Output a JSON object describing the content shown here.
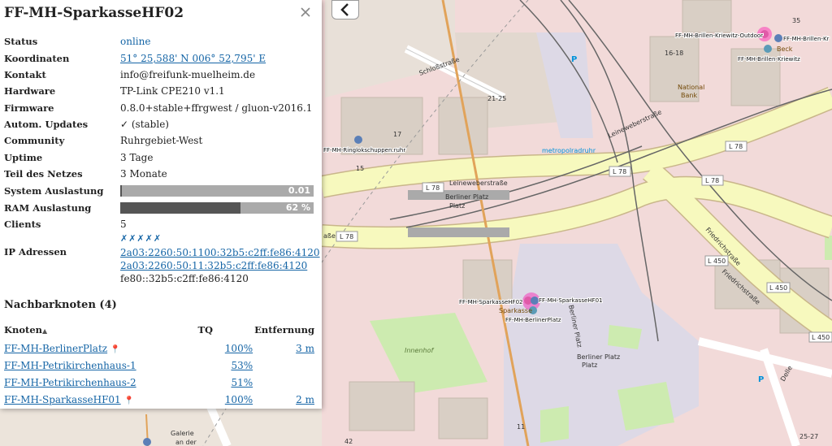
{
  "panel": {
    "title": "FF-MH-SparkasseHF02",
    "rows": {
      "status": {
        "label": "Status",
        "value": "online"
      },
      "coords": {
        "label": "Koordinaten",
        "value": "51° 25,588' N 006° 52,795' E"
      },
      "contact": {
        "label": "Kontakt",
        "value": "info@freifunk-muelheim.de"
      },
      "hardware": {
        "label": "Hardware",
        "value": "TP-Link CPE210 v1.1"
      },
      "firmware": {
        "label": "Firmware",
        "value": "0.8.0+stable+ffrgwest / gluon-v2016.1"
      },
      "autoupdate": {
        "label": "Autom. Updates",
        "value": "✓ (stable)"
      },
      "community": {
        "label": "Community",
        "value": "Ruhrgebiet-West"
      },
      "uptime": {
        "label": "Uptime",
        "value": "3 Tage"
      },
      "netpart": {
        "label": "Teil des Netzes",
        "value": "3 Monate"
      },
      "sysload": {
        "label": "System Auslastung",
        "text": "0.01",
        "fraction": 0.01
      },
      "ram": {
        "label": "RAM Auslastung",
        "text": "62 %",
        "fraction": 0.62
      },
      "clients": {
        "label": "Clients",
        "value": "5",
        "icons": "✗✗✗✗✗"
      },
      "ip": {
        "label": "IP Adressen",
        "addresses": [
          "2a03:2260:50:1100:32b5:c2ff:fe86:4120",
          "2a03:2260:50:11:32b5:c2ff:fe86:4120",
          "fe80::32b5:c2ff:fe86:4120"
        ]
      }
    },
    "neighbours_title": "Nachbarknoten (4)",
    "table": {
      "headers": {
        "node": "Knoten",
        "sort_icon": "▲",
        "tq": "TQ",
        "distance": "Entfernung"
      },
      "rows": [
        {
          "name": "FF-MH-BerlinerPlatz",
          "pin": true,
          "tq": "100%",
          "distance": "3 m"
        },
        {
          "name": "FF-MH-Petrikirchenhaus-1",
          "pin": false,
          "tq": "53%",
          "distance": ""
        },
        {
          "name": "FF-MH-Petrikirchenhaus-2",
          "pin": false,
          "tq": "51%",
          "distance": ""
        },
        {
          "name": "FF-MH-SparkasseHF01",
          "pin": true,
          "tq": "100%",
          "distance": "2 m"
        }
      ]
    },
    "colors": {
      "link": "#1565a6",
      "bar_bg": "#aaaaaa",
      "bar_sys": "#555555",
      "bar_ram": "#555555"
    }
  },
  "map": {
    "streets": [
      "Schloßstraße",
      "Leineweberstraße",
      "Leineweberstraße",
      "Friedrichstraße",
      "Friedrichstraße",
      "Berliner Platz",
      "Berliner Platz",
      "Berliner Platz",
      "Delle",
      "Innenhof",
      "Galerie",
      "an der",
      "aße"
    ],
    "refs": [
      "L 78",
      "L 78",
      "L 78",
      "L 78",
      "L 78",
      "L 450",
      "L 450",
      "L 450"
    ],
    "house_numbers": [
      "35",
      "16-18",
      "21-25",
      "17",
      "15",
      "11",
      "42",
      "25-27"
    ],
    "pois": [
      "National",
      "Bank",
      "metropolradruhr",
      "Beck",
      "Sparkasse"
    ],
    "nodes": [
      "FF-MH-Brillen-Kriewitz-Outdoor",
      "FF-MH-Brillen-Kr",
      "FF-MH-Brillen-Kriewitz",
      "FF-MH-Ringlokschuppen.ruhr",
      "FF-MH-SparkasseHF02",
      "FF-MH-SparkasseHF01",
      "FF-MH-BerlinerPlatz"
    ],
    "ghost_icons": [
      "P",
      "P"
    ]
  }
}
